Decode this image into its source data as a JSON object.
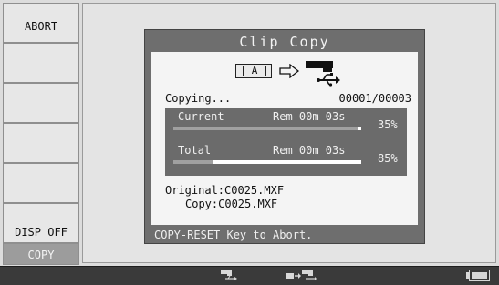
{
  "menu": {
    "abort_label": "ABORT",
    "disp_off_label": "DISP OFF",
    "copy_label": "COPY"
  },
  "dialog": {
    "title": "Clip Copy",
    "source_slot_label": "A",
    "status_text": "Copying...",
    "clip_counter": "00001/00003",
    "current": {
      "label": "Current",
      "remaining": "Rem 00m 03s",
      "percent_text": "35%",
      "progress": 0.98
    },
    "total": {
      "label": "Total",
      "remaining": "Rem 00m 03s",
      "percent_text": "85%",
      "progress": 0.21
    },
    "original_line": "Original:C0025.MXF",
    "copy_line": "Copy:C0025.MXF",
    "footer_hint": "COPY-RESET Key to Abort."
  },
  "status_bar": {
    "icons": [
      "usb-device-icon",
      "card-to-usb-icon",
      "battery-icon"
    ]
  },
  "colors": {
    "dialog_bg": "#6e6e6e",
    "content_bg": "#f4f4f4",
    "active_menu": "#9c9c9c",
    "status_bar": "#3a3a3a"
  }
}
